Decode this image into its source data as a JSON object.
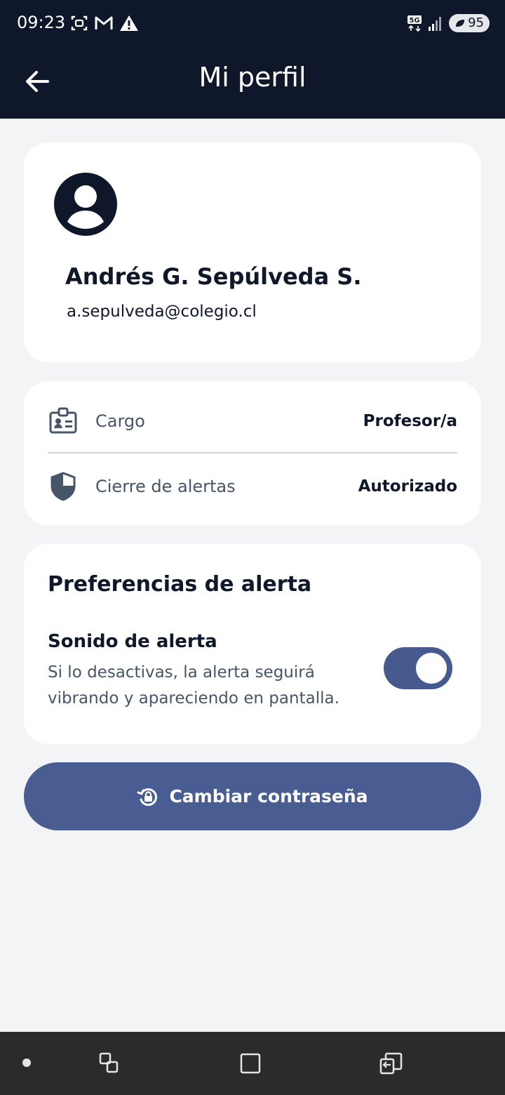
{
  "status_bar": {
    "time": "09:23",
    "battery": "95",
    "network": "5G",
    "left_icons": [
      "screenshot-icon",
      "gmail-icon",
      "warning-icon"
    ],
    "right_icons": [
      "5g-icon",
      "signal-icon",
      "battery-icon"
    ]
  },
  "header": {
    "title": "Mi perfil",
    "back_icon": "arrow-left-icon"
  },
  "profile": {
    "name": "Andrés G. Sepúlveda S.",
    "email": "a.sepulveda@colegio.cl",
    "avatar_icon": "user-avatar-icon"
  },
  "info": {
    "rows": [
      {
        "label": "Cargo",
        "value": "Profesor/a",
        "icon": "id-badge-icon"
      },
      {
        "label": "Cierre de alertas",
        "value": "Autorizado",
        "icon": "shield-icon"
      }
    ]
  },
  "preferences": {
    "title": "Preferencias de alerta",
    "sound_title": "Sonido de alerta",
    "sound_description": "Si lo desactivas, la alerta seguirá vibrando y apareciendo en pantalla.",
    "sound_enabled": true
  },
  "change_password": {
    "label": "Cambiar contraseña",
    "icon": "lock-reset-icon"
  },
  "nav": {
    "icons": [
      "nav-dot-icon",
      "recent-apps-icon",
      "home-square-icon",
      "back-nav-icon"
    ]
  },
  "colors": {
    "header_bg": "#0f172a",
    "page_bg": "#f3f4f6",
    "accent": "#495d93",
    "nav_bg": "#2b2b2b"
  }
}
